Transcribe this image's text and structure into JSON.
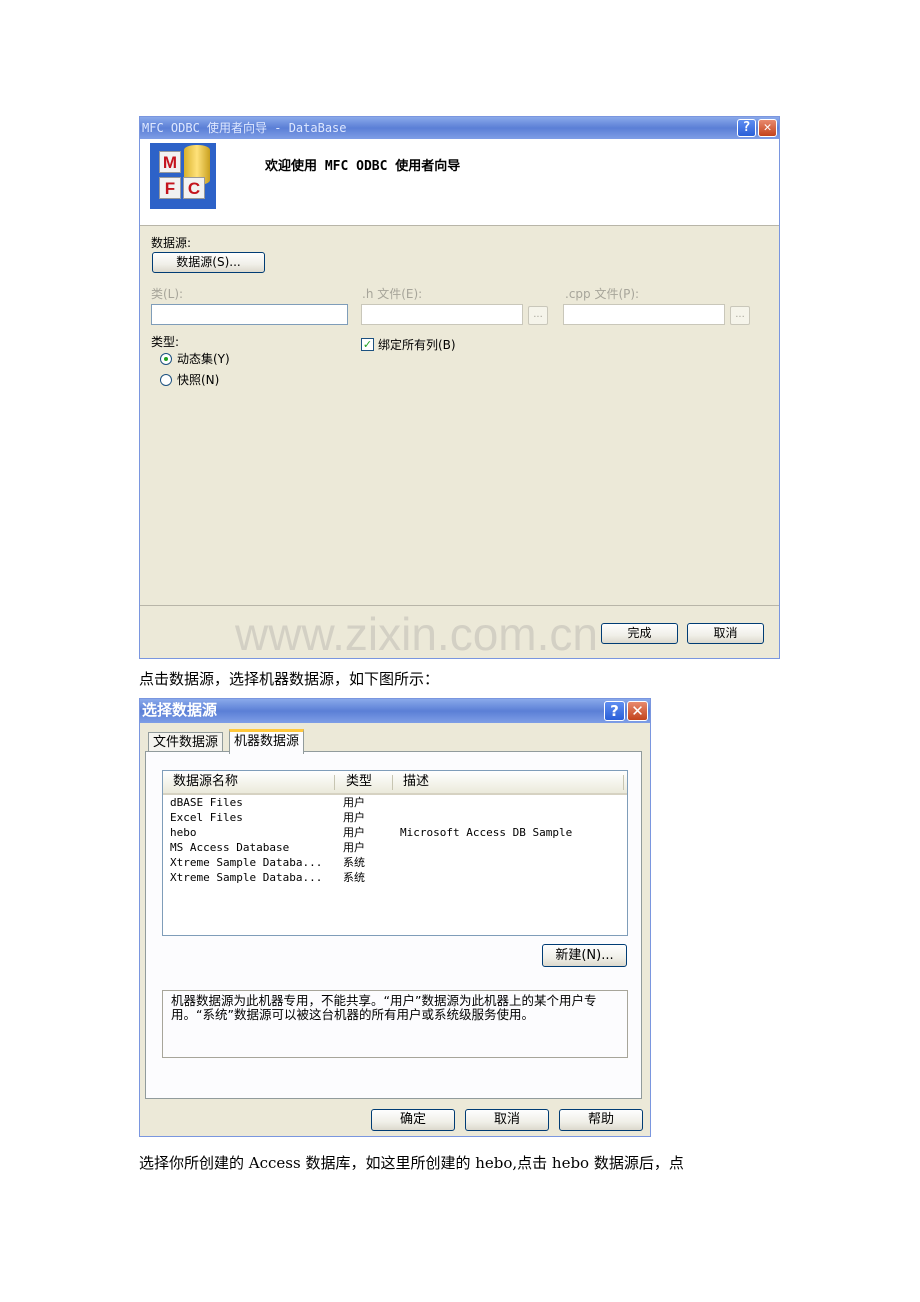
{
  "wizard": {
    "title": "MFC ODBC 使用者向导 - DataBase",
    "header_text": "欢迎使用 MFC ODBC 使用者向导",
    "logo_letters": [
      "M",
      "F",
      "C"
    ],
    "datasource_label": "数据源:",
    "datasource_button": "数据源(S)...",
    "class_label": "类(L):",
    "h_file_label": ".h 文件(E):",
    "cpp_file_label": ".cpp 文件(P):",
    "ellipsis": "...",
    "type_label": "类型:",
    "radio_dynaset": "动态集(Y)",
    "radio_snapshot": "快照(N)",
    "bind_all_columns": "绑定所有列(B)",
    "finish_button": "完成",
    "cancel_button": "取消",
    "watermark": "www.zixin.com.cn",
    "selected_type": "dynaset",
    "bind_checked": true
  },
  "paragraph1": "点击数据源，选择机器数据源，如下图所示：",
  "dsn_dialog": {
    "title": "选择数据源",
    "tabs": [
      "文件数据源",
      "机器数据源"
    ],
    "active_tab": 1,
    "columns": [
      "数据源名称",
      "类型",
      "描述"
    ],
    "rows": [
      {
        "name": "dBASE Files",
        "type": "用户",
        "desc": ""
      },
      {
        "name": "Excel Files",
        "type": "用户",
        "desc": ""
      },
      {
        "name": "hebo",
        "type": "用户",
        "desc": "Microsoft Access DB Sample"
      },
      {
        "name": "MS Access Database",
        "type": "用户",
        "desc": ""
      },
      {
        "name": "Xtreme Sample Databa...",
        "type": "系统",
        "desc": ""
      },
      {
        "name": "Xtreme Sample Databa...",
        "type": "系统",
        "desc": ""
      }
    ],
    "new_button": "新建(N)...",
    "description_text": "机器数据源为此机器专用，不能共享。“用户”数据源为此机器上的某个用户专用。“系统”数据源可以被这台机器的所有用户或系统级服务使用。",
    "ok_button": "确定",
    "cancel_button": "取消",
    "help_button": "帮助"
  },
  "paragraph2": "选择你所创建的 Access 数据库，如这里所创建的 hebo,点击 hebo 数据源后，点",
  "icons": [
    "help-icon",
    "close-icon"
  ]
}
